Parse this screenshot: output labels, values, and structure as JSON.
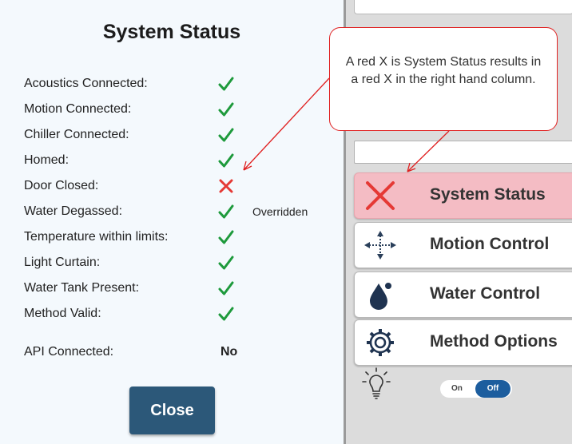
{
  "status_panel": {
    "title": "System Status",
    "rows": [
      {
        "label": "Acoustics Connected:",
        "status": "check",
        "note": ""
      },
      {
        "label": "Motion Connected:",
        "status": "check",
        "note": ""
      },
      {
        "label": "Chiller Connected:",
        "status": "check",
        "note": ""
      },
      {
        "label": "Homed:",
        "status": "check",
        "note": ""
      },
      {
        "label": "Door Closed:",
        "status": "cross",
        "note": ""
      },
      {
        "label": "Water Degassed:",
        "status": "check",
        "note": "Overridden"
      },
      {
        "label": "Temperature within limits:",
        "status": "check",
        "note": ""
      },
      {
        "label": "Light Curtain:",
        "status": "check",
        "note": ""
      },
      {
        "label": "Water Tank Present:",
        "status": "check",
        "note": ""
      },
      {
        "label": "Method Valid:",
        "status": "check",
        "note": ""
      }
    ],
    "api": {
      "label": "API Connected:",
      "value": "No"
    },
    "close_label": "Close"
  },
  "annotation": {
    "text": "A red X is System Status results in a red X in the right hand column."
  },
  "nav": [
    {
      "label": "System Status",
      "icon": "red-x-icon",
      "active": true
    },
    {
      "label": "Motion Control",
      "icon": "move-arrows-icon",
      "active": false
    },
    {
      "label": "Water Control",
      "icon": "water-drop-icon",
      "active": false
    },
    {
      "label": "Method Options",
      "icon": "gear-icon",
      "active": false
    }
  ],
  "light_toggle": {
    "icon": "light-bulb-icon",
    "on_label": "On",
    "off_label": "Off",
    "state": "Off"
  },
  "colors": {
    "check": "#1e9a3c",
    "cross": "#e53935",
    "close_button": "#2c5879",
    "active_nav": "#f4bcc4",
    "callout_border": "#e02020",
    "toggle_active": "#1c5d9e"
  }
}
